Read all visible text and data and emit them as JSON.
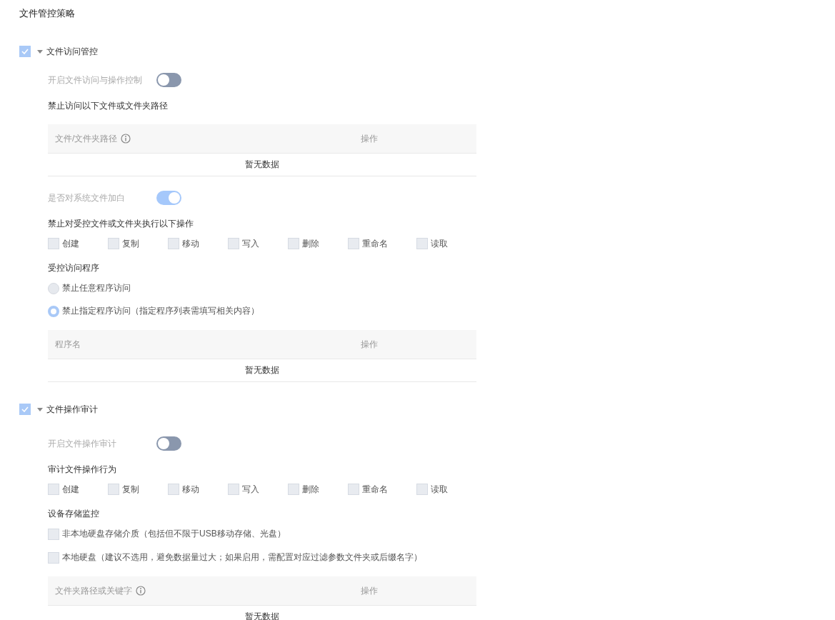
{
  "title": "文件管控策略",
  "sections": [
    {
      "label": "文件访问管控",
      "checked": true,
      "expanded": true,
      "blocks": [
        {
          "kind": "toggle",
          "label": "开启文件访问与操作控制",
          "on": false
        },
        {
          "kind": "heading",
          "text": "禁止访问以下文件或文件夹路径"
        },
        {
          "kind": "table",
          "columns": [
            {
              "label": "文件/文件夹路径",
              "info": true
            },
            {
              "label": "操作",
              "info": false
            }
          ],
          "empty": "暂无数据"
        },
        {
          "kind": "toggle",
          "label": "是否对系统文件加白",
          "on": true
        },
        {
          "kind": "heading",
          "text": "禁止对受控文件或文件夹执行以下操作"
        },
        {
          "kind": "checks",
          "options": [
            {
              "label": "创建",
              "checked": false
            },
            {
              "label": "复制",
              "checked": false
            },
            {
              "label": "移动",
              "checked": false
            },
            {
              "label": "写入",
              "checked": false
            },
            {
              "label": "删除",
              "checked": false
            },
            {
              "label": "重命名",
              "checked": false
            },
            {
              "label": "读取",
              "checked": false
            }
          ]
        },
        {
          "kind": "heading",
          "text": "受控访问程序"
        },
        {
          "kind": "radios",
          "options": [
            {
              "label": "禁止任意程序访问",
              "selected": false
            },
            {
              "label": "禁止指定程序访问（指定程序列表需填写相关内容）",
              "selected": true
            }
          ]
        },
        {
          "kind": "table",
          "columns": [
            {
              "label": "程序名",
              "info": false
            },
            {
              "label": "操作",
              "info": false
            }
          ],
          "empty": "暂无数据"
        }
      ]
    },
    {
      "label": "文件操作审计",
      "checked": true,
      "expanded": true,
      "blocks": [
        {
          "kind": "toggle",
          "label": "开启文件操作审计",
          "on": false
        },
        {
          "kind": "heading",
          "text": "审计文件操作行为"
        },
        {
          "kind": "checks",
          "options": [
            {
              "label": "创建",
              "checked": false
            },
            {
              "label": "复制",
              "checked": false
            },
            {
              "label": "移动",
              "checked": false
            },
            {
              "label": "写入",
              "checked": false
            },
            {
              "label": "删除",
              "checked": false
            },
            {
              "label": "重命名",
              "checked": false
            },
            {
              "label": "读取",
              "checked": false
            }
          ]
        },
        {
          "kind": "heading",
          "text": "设备存储监控"
        },
        {
          "kind": "checklist",
          "options": [
            {
              "label": "非本地硬盘存储介质（包括但不限于USB移动存储、光盘）",
              "checked": false
            },
            {
              "label": "本地硬盘（建议不选用，避免数据量过大；如果启用，需配置对应过滤参数文件夹或后缀名字）",
              "checked": false
            }
          ]
        },
        {
          "kind": "table",
          "columns": [
            {
              "label": "文件夹路径或关键字",
              "info": true
            },
            {
              "label": "操作",
              "info": false
            }
          ],
          "empty": "暂无数据"
        }
      ]
    }
  ]
}
